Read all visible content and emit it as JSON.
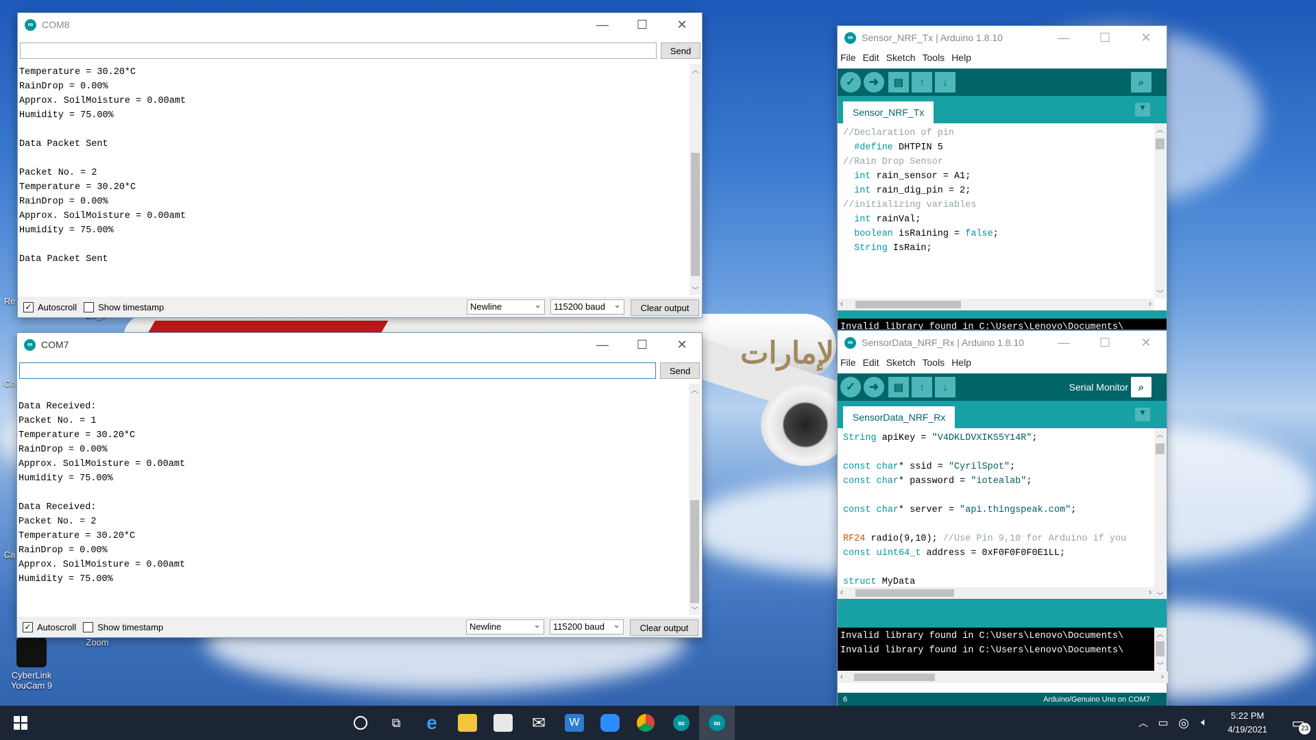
{
  "desktop": {
    "icons": [
      {
        "label": "Re",
        "id": "re"
      },
      {
        "label": "Edge",
        "id": "edge"
      },
      {
        "label": "Co",
        "id": "co"
      },
      {
        "label": "Ca",
        "id": "ca"
      },
      {
        "label": "CyberLink YouCam 9",
        "id": "youcam"
      },
      {
        "label": "Zoom",
        "id": "zoom"
      }
    ],
    "plane_text": "الإمارات"
  },
  "com8": {
    "title": "COM8",
    "input_value": "",
    "send_label": "Send",
    "output_lines": [
      "Temperature = 30.20*C",
      "RainDrop = 0.00%",
      "Approx. SoilMoisture = 0.00amt",
      "Humidity = 75.00%",
      "",
      "Data Packet Sent",
      "",
      "Packet No. = 2",
      "Temperature = 30.20*C",
      "RainDrop = 0.00%",
      "Approx. SoilMoisture = 0.00amt",
      "Humidity = 75.00%",
      "",
      "Data Packet Sent"
    ],
    "autoscroll_label": "Autoscroll",
    "autoscroll_checked": true,
    "timestamp_label": "Show timestamp",
    "timestamp_checked": false,
    "line_ending": "Newline",
    "baud": "115200 baud",
    "clear_label": "Clear output"
  },
  "com7": {
    "title": "COM7",
    "input_value": "",
    "send_label": "Send",
    "output_lines": [
      "Data Received:",
      "Packet No. = 1",
      "Temperature = 30.20*C",
      "RainDrop = 0.00%",
      "Approx. SoilMoisture = 0.00amt",
      "Humidity = 75.00%",
      "",
      "Data Received:",
      "Packet No. = 2",
      "Temperature = 30.20*C",
      "RainDrop = 0.00%",
      "Approx. SoilMoisture = 0.00amt",
      "Humidity = 75.00%"
    ],
    "autoscroll_label": "Autoscroll",
    "autoscroll_checked": true,
    "timestamp_label": "Show timestamp",
    "timestamp_checked": false,
    "line_ending": "Newline",
    "baud": "115200 baud",
    "clear_label": "Clear output"
  },
  "ide_tx": {
    "title": "Sensor_NRF_Tx | Arduino 1.8.10",
    "menu": [
      "File",
      "Edit",
      "Sketch",
      "Tools",
      "Help"
    ],
    "tab": "Sensor_NRF_Tx",
    "code": [
      {
        "parts": [
          {
            "t": "//Declaration of pin",
            "c": "cm"
          }
        ]
      },
      {
        "parts": [
          {
            "t": "  ",
            "c": ""
          },
          {
            "t": "#define",
            "c": "kw"
          },
          {
            "t": " DHTPIN 5",
            "c": ""
          }
        ]
      },
      {
        "parts": [
          {
            "t": "//Rain Drop Sensor",
            "c": "cm"
          }
        ]
      },
      {
        "parts": [
          {
            "t": "  ",
            "c": ""
          },
          {
            "t": "int",
            "c": "kw"
          },
          {
            "t": " rain_sensor = A1;",
            "c": ""
          }
        ]
      },
      {
        "parts": [
          {
            "t": "  ",
            "c": ""
          },
          {
            "t": "int",
            "c": "kw"
          },
          {
            "t": " rain_dig_pin = 2;",
            "c": ""
          }
        ]
      },
      {
        "parts": [
          {
            "t": "//initializing variables",
            "c": "cm"
          }
        ]
      },
      {
        "parts": [
          {
            "t": "  ",
            "c": ""
          },
          {
            "t": "int",
            "c": "kw"
          },
          {
            "t": " rainVal;",
            "c": ""
          }
        ]
      },
      {
        "parts": [
          {
            "t": "  ",
            "c": ""
          },
          {
            "t": "boolean",
            "c": "kw"
          },
          {
            "t": " isRaining = ",
            "c": ""
          },
          {
            "t": "false",
            "c": "kw"
          },
          {
            "t": ";",
            "c": ""
          }
        ]
      },
      {
        "parts": [
          {
            "t": "  ",
            "c": ""
          },
          {
            "t": "String",
            "c": "kw"
          },
          {
            "t": " IsRain;",
            "c": ""
          }
        ]
      }
    ],
    "console": [
      "Invalid library found in C:\\Users\\Lenovo\\Documents\\"
    ]
  },
  "ide_rx": {
    "title": "SensorData_NRF_Rx | Arduino 1.8.10",
    "menu": [
      "File",
      "Edit",
      "Sketch",
      "Tools",
      "Help"
    ],
    "serial_monitor_label": "Serial Monitor",
    "tab": "SensorData_NRF_Rx",
    "code": [
      {
        "parts": [
          {
            "t": "String",
            "c": "kw"
          },
          {
            "t": " apiKey = ",
            "c": ""
          },
          {
            "t": "\"V4DKLDVXIKS5Y14R\"",
            "c": "st"
          },
          {
            "t": ";",
            "c": ""
          }
        ]
      },
      {
        "parts": [
          {
            "t": "",
            "c": ""
          }
        ]
      },
      {
        "parts": [
          {
            "t": "const",
            "c": "kw"
          },
          {
            "t": " ",
            "c": ""
          },
          {
            "t": "char",
            "c": "kw"
          },
          {
            "t": "* ssid = ",
            "c": ""
          },
          {
            "t": "\"CyrilSpot\"",
            "c": "st"
          },
          {
            "t": ";",
            "c": ""
          }
        ]
      },
      {
        "parts": [
          {
            "t": "const",
            "c": "kw"
          },
          {
            "t": " ",
            "c": ""
          },
          {
            "t": "char",
            "c": "kw"
          },
          {
            "t": "* password = ",
            "c": ""
          },
          {
            "t": "\"iotealab\"",
            "c": "st"
          },
          {
            "t": ";",
            "c": ""
          }
        ]
      },
      {
        "parts": [
          {
            "t": "",
            "c": ""
          }
        ]
      },
      {
        "parts": [
          {
            "t": "const",
            "c": "kw"
          },
          {
            "t": " ",
            "c": ""
          },
          {
            "t": "char",
            "c": "kw"
          },
          {
            "t": "* server = ",
            "c": ""
          },
          {
            "t": "\"api.thingspeak.com\"",
            "c": "st"
          },
          {
            "t": ";",
            "c": ""
          }
        ]
      },
      {
        "parts": [
          {
            "t": "",
            "c": ""
          }
        ]
      },
      {
        "parts": [
          {
            "t": "RF24",
            "c": "kw2"
          },
          {
            "t": " radio(9,10); ",
            "c": ""
          },
          {
            "t": "//Use Pin 9,10 for Arduino if you",
            "c": "cm"
          }
        ]
      },
      {
        "parts": [
          {
            "t": "const",
            "c": "kw"
          },
          {
            "t": " ",
            "c": ""
          },
          {
            "t": "uint64_t",
            "c": "kw"
          },
          {
            "t": " address = 0xF0F0F0F0E1LL;",
            "c": ""
          }
        ]
      },
      {
        "parts": [
          {
            "t": "",
            "c": ""
          }
        ]
      },
      {
        "parts": [
          {
            "t": "struct",
            "c": "kw"
          },
          {
            "t": " MyData",
            "c": ""
          }
        ]
      }
    ],
    "console": [
      "Invalid library found in C:\\Users\\Lenovo\\Documents\\",
      "Invalid library found in C:\\Users\\Lenovo\\Documents\\"
    ],
    "status_line": "6",
    "status_board": "Arduino/Genuino Uno on COM7"
  },
  "taskbar": {
    "time": "5:22 PM",
    "date": "4/19/2021",
    "notification_count": "23"
  }
}
